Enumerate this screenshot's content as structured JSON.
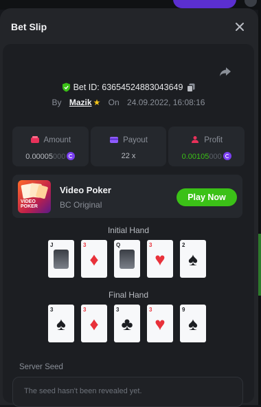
{
  "window": {
    "title": "Bet Slip"
  },
  "bet": {
    "id_label": "Bet ID: 63654524883043649",
    "by_label": "By",
    "user": "Mazik",
    "on_label": "On",
    "date": "24.09.2022, 16:08:16"
  },
  "stats": {
    "amount": {
      "label": "Amount",
      "value_main": "0.00005",
      "value_dim": "000"
    },
    "payout": {
      "label": "Payout",
      "value": "22 x"
    },
    "profit": {
      "label": "Profit",
      "value_main": "0.00105",
      "value_dim": "000"
    }
  },
  "game": {
    "name": "Video Poker",
    "provider": "BC Original",
    "play_label": "Play Now",
    "logo_text_1": "VIDEO",
    "logo_text_2": "POKER"
  },
  "hands": {
    "initial_label": "Initial Hand",
    "final_label": "Final Hand",
    "initial": [
      {
        "rank": "J",
        "suit": "♣",
        "color": "black",
        "court": true
      },
      {
        "rank": "3",
        "suit": "♦",
        "color": "red",
        "court": false
      },
      {
        "rank": "Q",
        "suit": "♣",
        "color": "black",
        "court": true
      },
      {
        "rank": "3",
        "suit": "♥",
        "color": "red",
        "court": false
      },
      {
        "rank": "2",
        "suit": "♠",
        "color": "black",
        "court": false
      }
    ],
    "final": [
      {
        "rank": "3",
        "suit": "♠",
        "color": "black",
        "court": false
      },
      {
        "rank": "3",
        "suit": "♦",
        "color": "red",
        "court": false
      },
      {
        "rank": "3",
        "suit": "♣",
        "color": "black",
        "court": false
      },
      {
        "rank": "3",
        "suit": "♥",
        "color": "red",
        "court": false
      },
      {
        "rank": "9",
        "suit": "♠",
        "color": "black",
        "court": false
      }
    ]
  },
  "seed": {
    "label": "Server Seed",
    "placeholder": "The seed hasn't been revealed yet."
  },
  "colors": {
    "accent_green": "#3bc117",
    "coin_purple": "#7b3ff2",
    "panel": "#1c1e22"
  }
}
